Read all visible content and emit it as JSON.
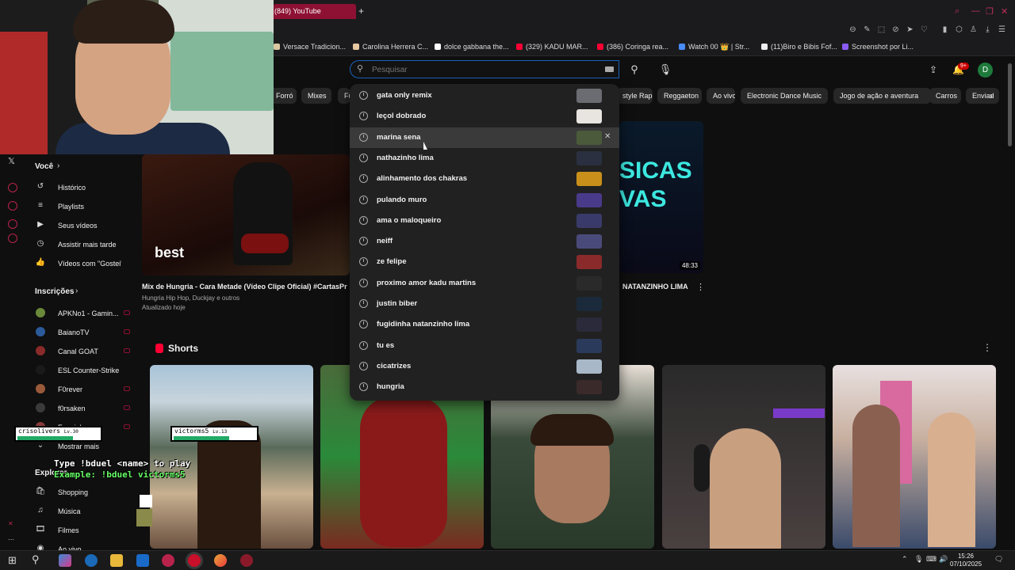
{
  "browser": {
    "active_tab_title": "(849) YouTube",
    "new_tab_icon": "plus-icon",
    "bookmarks": [
      {
        "label": "Versace Tradicion...",
        "color": "#d9c8a0"
      },
      {
        "label": "Carolina Herrera C...",
        "color": "#e8c8a0"
      },
      {
        "label": "dolce gabbana the...",
        "color": "#ffffff"
      },
      {
        "label": "(329) KADU MAR...",
        "color": "#ff0033"
      },
      {
        "label": "(386) Coringa rea...",
        "color": "#ff0033"
      },
      {
        "label": "Watch 00 👑 | Str...",
        "color": "#4a8cff"
      },
      {
        "label": "(11)Biro e Bibis Fof...",
        "color": "#eeeeee"
      },
      {
        "label": "Screenshot por Li...",
        "color": "#8a5cf6"
      }
    ]
  },
  "youtube": {
    "search": {
      "placeholder": "Pesquisar",
      "value": ""
    },
    "notifications_badge": "9+",
    "avatar_letter": "D",
    "chips": [
      "Forró",
      "Mixes",
      "Fu",
      "style Rap",
      "Reggaeton",
      "Ao vivo",
      "Electronic Dance Music",
      "Jogo de ação e aventura",
      "Carros",
      "Enviad"
    ],
    "suggestions": [
      {
        "text": "gata only remix",
        "thumb": "#6b6b72"
      },
      {
        "text": "leçol dobrado",
        "thumb": "#e8e4e0"
      },
      {
        "text": "marina sena",
        "thumb": "#4a5a3a",
        "remove": "✕"
      },
      {
        "text": "nathazinho lima",
        "thumb": "#2a3040"
      },
      {
        "text": "alinhamento dos chakras",
        "thumb": "#c8901a"
      },
      {
        "text": "pulando muro",
        "thumb": "#4a3a8a"
      },
      {
        "text": "ama o maloqueiro",
        "thumb": "#3a3a6a"
      },
      {
        "text": "neiff",
        "thumb": "#4a4a7a"
      },
      {
        "text": "ze felipe",
        "thumb": "#8a2a2a"
      },
      {
        "text": "proximo amor kadu martins",
        "thumb": "#2a2a2a"
      },
      {
        "text": "justin biber",
        "thumb": "#1a2a3a"
      },
      {
        "text": "fugidinha natanzinho lima",
        "thumb": "#2a2a3a"
      },
      {
        "text": "tu es",
        "thumb": "#2a3a5a"
      },
      {
        "text": "cicatrizes",
        "thumb": "#a8b8c8"
      },
      {
        "text": "hungria",
        "thumb": "#3a2a2a"
      }
    ],
    "sidebar": {
      "you_section": "Você",
      "you_items": [
        {
          "label": "Histórico",
          "icon": "history-icon",
          "glyph": "↺"
        },
        {
          "label": "Playlists",
          "icon": "playlist-icon",
          "glyph": "≡"
        },
        {
          "label": "Seus vídeos",
          "icon": "video-icon",
          "glyph": "▶"
        },
        {
          "label": "Assistir mais tarde",
          "icon": "clock-icon",
          "glyph": "◷"
        },
        {
          "label": "Vídeos com \"Gostei\"",
          "icon": "like-icon",
          "glyph": "👍"
        }
      ],
      "subs_section": "Inscrições",
      "subs": [
        {
          "label": "APKNo1 - Gamin...",
          "color": "#6a8a3a"
        },
        {
          "label": "BaianoTV",
          "color": "#2a5a9a"
        },
        {
          "label": "Canal GOAT",
          "color": "#8a2a2a"
        },
        {
          "label": "ESL Counter-Strike",
          "color": "#1a1a1a"
        },
        {
          "label": "F0rever",
          "color": "#9a5a3a"
        },
        {
          "label": "f0rsaken",
          "color": "#3a3a3a"
        },
        {
          "label": "Fequinha",
          "color": "#8a3a3a"
        }
      ],
      "show_more": "Mostrar mais",
      "explore_section": "Explorar",
      "explore_items": [
        {
          "label": "Shopping",
          "icon": "shopping-icon",
          "glyph": "🛍"
        },
        {
          "label": "Música",
          "icon": "music-icon",
          "glyph": "♫"
        },
        {
          "label": "Filmes",
          "icon": "film-icon",
          "glyph": "🎞"
        },
        {
          "label": "Ao vivo",
          "icon": "live-icon",
          "glyph": "◉"
        }
      ]
    },
    "featured_video": {
      "title": "Mix de Hungria - Cara Metade (Vídeo Clipe Oficial) #CartasPr",
      "channel": "Hungria Hip Hop, Duckjay e outros",
      "updated": "Atualizado hoje",
      "thumb_brand": "best"
    },
    "second_video": {
      "title": "NATANZINHO LIMA",
      "duration": "48:33",
      "thumb_text": "SICAS\nVAS"
    },
    "shorts_title": "Shorts"
  },
  "overlay": {
    "player1": {
      "name": "crisolivers",
      "level": "Lv.30",
      "hp": "HP:"
    },
    "player2": {
      "name": "victorms5",
      "level": "Lv.13",
      "hp": "HP:"
    },
    "line1": "Type !bduel <name> to play",
    "line2": "Example: !bduel victorms5"
  },
  "taskbar": {
    "time": "15:26",
    "date": "07/10/2025"
  }
}
